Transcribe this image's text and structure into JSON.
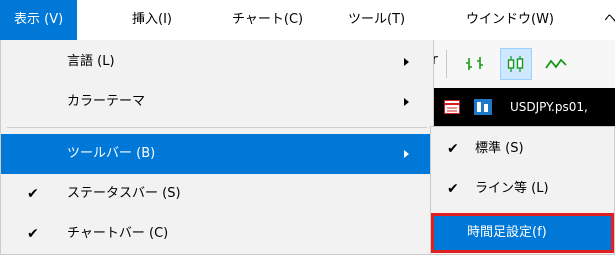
{
  "menubar": {
    "items": [
      {
        "label": "表示 (V)",
        "active": true
      },
      {
        "label": "挿入(I)"
      },
      {
        "label": "チャート(C)"
      },
      {
        "label": "ツール(T)"
      },
      {
        "label": "ウインドウ(W)"
      },
      {
        "label": "ヘ"
      }
    ]
  },
  "view_menu": {
    "items": [
      {
        "label": "言語 (L)",
        "has_submenu": true
      },
      {
        "label": "カラーテーマ",
        "has_submenu": true
      },
      {
        "label": "ツールバー (B)",
        "has_submenu": true,
        "highlighted": true
      },
      {
        "label": "ステータスバー (S)",
        "checked": true
      },
      {
        "label": "チャートバー (C)",
        "checked": true
      }
    ]
  },
  "toolbar_submenu": {
    "items": [
      {
        "label": "標準 (S)",
        "checked": true
      },
      {
        "label": "ライン等 (L)",
        "checked": true
      },
      {
        "label": "時間足設定(f)",
        "highlighted": true,
        "outline_color": "#e02020"
      }
    ]
  },
  "chart_tab": {
    "label": "USDJPY.ps01,"
  },
  "colors": {
    "accent": "#0078d7",
    "highlight_outline": "#e02020",
    "chart_green": "#1a9a1a"
  },
  "check_glyph": "✔"
}
